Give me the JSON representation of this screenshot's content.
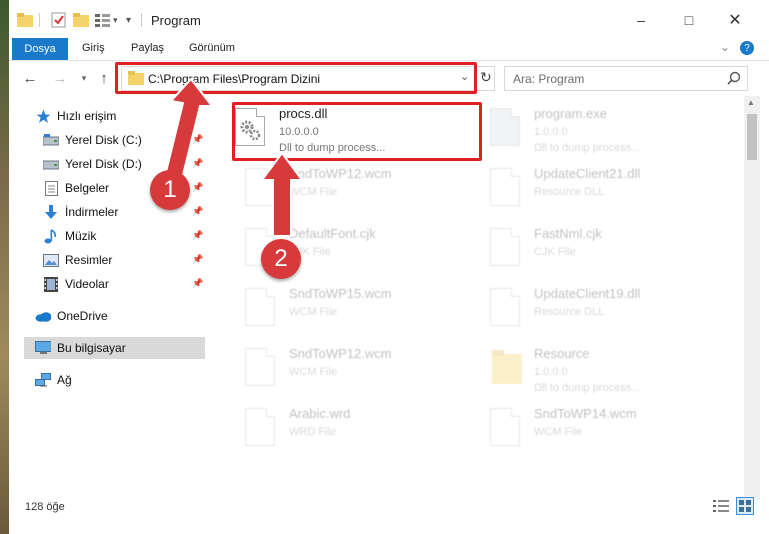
{
  "window": {
    "title": "Program"
  },
  "ribbon": {
    "tabs": [
      "Dosya",
      "Giriş",
      "Paylaş",
      "Görünüm"
    ]
  },
  "address": {
    "path": "C:\\Program Files\\Program Dizini"
  },
  "search": {
    "placeholder": "Ara: Program"
  },
  "sidebar": {
    "items": [
      {
        "label": "Hızlı erişim",
        "icon": "star-icon"
      },
      {
        "label": "Yerel Disk (C:)",
        "icon": "drive-icon"
      },
      {
        "label": "Yerel Disk (D:)",
        "icon": "drive-icon"
      },
      {
        "label": "Belgeler",
        "icon": "documents-icon"
      },
      {
        "label": "İndirmeler",
        "icon": "download-icon"
      },
      {
        "label": "Müzik",
        "icon": "music-icon"
      },
      {
        "label": "Resimler",
        "icon": "pictures-icon"
      },
      {
        "label": "Videolar",
        "icon": "videos-icon"
      },
      {
        "label": "OneDrive",
        "icon": "cloud-icon"
      },
      {
        "label": "Bu bilgisayar",
        "icon": "computer-icon"
      },
      {
        "label": "Ağ",
        "icon": "network-icon"
      }
    ]
  },
  "files": [
    {
      "name": "procs.dll",
      "line2": "10.0.0.0",
      "line3": "Dll to dump process..."
    },
    {
      "name": "program.exe",
      "line2": "1.0.0.0",
      "line3": "Dll to dump process..."
    },
    {
      "name": "SndToWP12.wcm",
      "line2": "WCM File",
      "line3": ""
    },
    {
      "name": "UpdateClient21.dll",
      "line2": "Resource DLL",
      "line3": ""
    },
    {
      "name": "DefaultFont.cjk",
      "line2": "CJK File",
      "line3": ""
    },
    {
      "name": "FastNml.cjk",
      "line2": "CJK File",
      "line3": ""
    },
    {
      "name": "SndToWP15.wcm",
      "line2": "WCM File",
      "line3": ""
    },
    {
      "name": "UpdateClient19.dll",
      "line2": "Resource DLL",
      "line3": ""
    },
    {
      "name": "SndToWP12.wcm",
      "line2": "WCM File",
      "line3": ""
    },
    {
      "name": "Resource",
      "line2": "1.0.0.0",
      "line3": "Dll to dump process..."
    },
    {
      "name": "Arabic.wrd",
      "line2": "WRD File",
      "line3": ""
    },
    {
      "name": "SndToWP14.wcm",
      "line2": "WCM File",
      "line3": ""
    }
  ],
  "status": {
    "count": "128 öğe"
  },
  "annotations": [
    {
      "label": "1"
    },
    {
      "label": "2"
    }
  ],
  "colors": {
    "accent": "#1979ca",
    "highlight": "#e02020",
    "badge": "#d73a3a"
  }
}
